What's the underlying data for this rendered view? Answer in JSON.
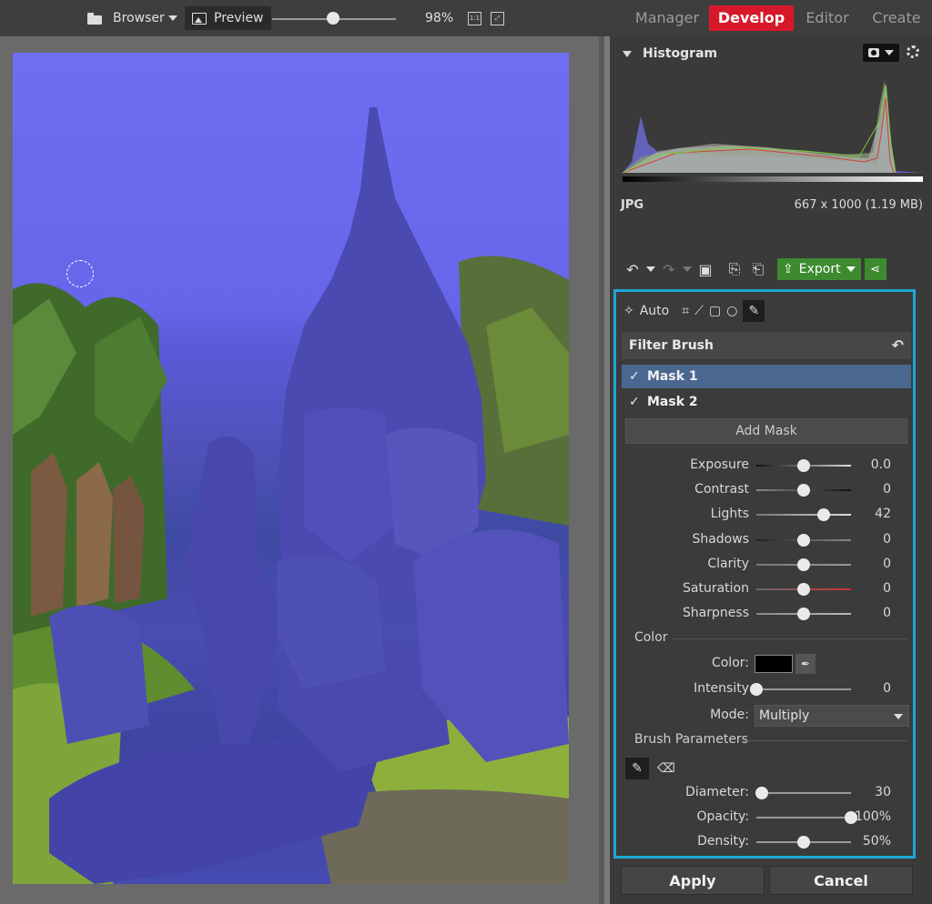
{
  "topbar": {
    "browser_label": "Browser",
    "preview_label": "Preview",
    "zoom_value": "98%",
    "one_to_one": "1:1",
    "modes": [
      "Manager",
      "Develop",
      "Editor",
      "Create"
    ],
    "active_mode": "Develop"
  },
  "histogram": {
    "title": "Histogram",
    "format": "JPG",
    "dimensions": "667 x 1000 (1.19 MB)"
  },
  "toolbar": {
    "export_label": "Export"
  },
  "filter": {
    "auto_label": "Auto",
    "title": "Filter Brush",
    "masks": [
      {
        "label": "Mask 1",
        "checked": true,
        "selected": true
      },
      {
        "label": "Mask 2",
        "checked": true,
        "selected": false
      }
    ],
    "add_mask_label": "Add Mask",
    "adjustments": [
      {
        "label": "Exposure",
        "value": "0.0",
        "level": 0.5
      },
      {
        "label": "Contrast",
        "value": "0",
        "level": 0.5
      },
      {
        "label": "Lights",
        "value": "42",
        "level": 0.71
      },
      {
        "label": "Shadows",
        "value": "0",
        "level": 0.5
      },
      {
        "label": "Clarity",
        "value": "0",
        "level": 0.5
      },
      {
        "label": "Saturation",
        "value": "0",
        "level": 0.5
      },
      {
        "label": "Sharpness",
        "value": "0",
        "level": 0.5
      }
    ],
    "color_section": "Color",
    "color_label": "Color:",
    "color_value": "#000000",
    "intensity": {
      "label": "Intensity",
      "value": "0",
      "level": 0.0
    },
    "mode_label": "Mode:",
    "mode_value": "Multiply",
    "brush_section": "Brush Parameters",
    "brush": [
      {
        "label": "Diameter:",
        "value": "30",
        "level": 0.06
      },
      {
        "label": "Opacity:",
        "value": "100%",
        "level": 1.0
      },
      {
        "label": "Density:",
        "value": "50%",
        "level": 0.5
      }
    ]
  },
  "buttons": {
    "apply": "Apply",
    "cancel": "Cancel"
  },
  "colors": {
    "active_tab": "#d7182a",
    "export_green": "#3d8a2f",
    "highlight_border": "#1ea8d6",
    "selected_mask": "#4a6790",
    "mask_overlay": "#6a6af0"
  }
}
